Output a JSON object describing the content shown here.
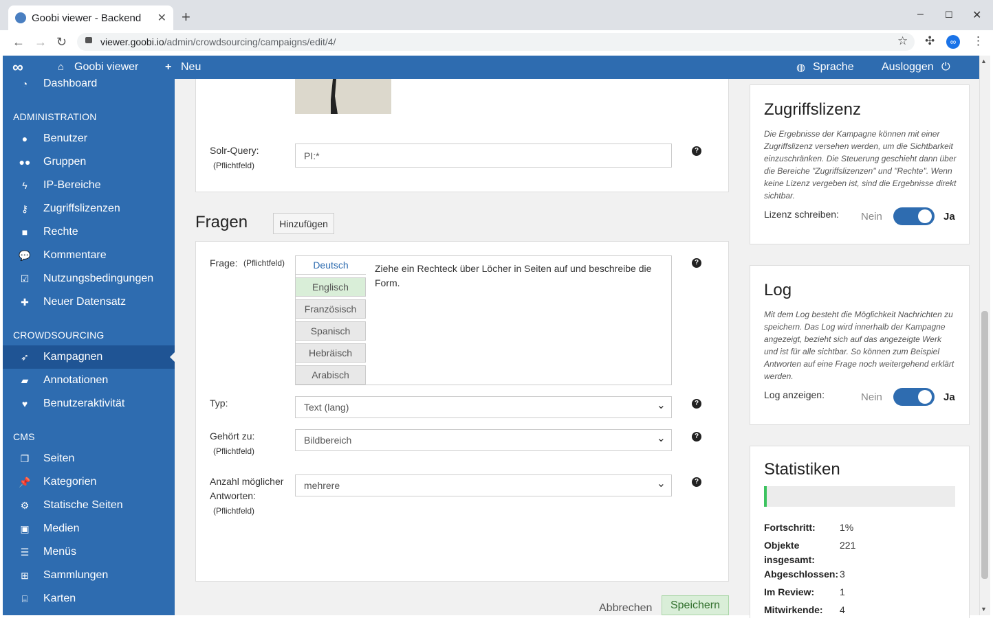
{
  "browser": {
    "tab_title": "Goobi viewer - Backend",
    "url_host": "viewer.goobi.io",
    "url_path": "/admin/crowdsourcing/campaigns/edit/4/"
  },
  "topnav": {
    "brand": "Goobi viewer",
    "new": "Neu",
    "language": "Sprache",
    "logout": "Ausloggen"
  },
  "sidebar": {
    "dashboard": "Dashboard",
    "admin_heading": "ADMINISTRATION",
    "admin_items": [
      "Benutzer",
      "Gruppen",
      "IP-Bereiche",
      "Zugriffslizenzen",
      "Rechte",
      "Kommentare",
      "Nutzungsbedingungen",
      "Neuer Datensatz"
    ],
    "crowd_heading": "CROWDSOURCING",
    "crowd_items": [
      "Kampagnen",
      "Annotationen",
      "Benutzeraktivität"
    ],
    "cms_heading": "CMS",
    "cms_items": [
      "Seiten",
      "Kategorien",
      "Statische Seiten",
      "Medien",
      "Menüs",
      "Sammlungen",
      "Karten"
    ]
  },
  "main": {
    "solr_label": "Solr-Query:",
    "required": "(Pflichtfeld)",
    "solr_value": "PI:*",
    "questions_heading": "Fragen",
    "add_button": "Hinzufügen",
    "question_label": "Frage:",
    "languages": [
      "Deutsch",
      "Englisch",
      "Französisch",
      "Spanisch",
      "Hebräisch",
      "Arabisch"
    ],
    "question_text": "Ziehe ein Rechteck über Löcher in Seiten auf und beschreibe die Form.",
    "type_label": "Typ:",
    "type_value": "Text (lang)",
    "belongs_label": "Gehört zu:",
    "belongs_value": "Bildbereich",
    "answers_label_1": "Anzahl möglicher",
    "answers_label_2": "Antworten:",
    "answers_value": "mehrere",
    "cancel": "Abbrechen",
    "save": "Speichern"
  },
  "license": {
    "title": "Zugriffslizenz",
    "description": "Die Ergebnisse der Kampagne können mit einer Zugriffslizenz versehen werden, um die Sichtbarkeit einzuschränken. Die Steuerung geschieht dann über die Bereiche \"Zugriffslizenzen\" und \"Rechte\". Wenn keine Lizenz vergeben ist, sind die Ergebnisse direkt sichtbar.",
    "toggle_label": "Lizenz schreiben:",
    "no": "Nein",
    "yes": "Ja"
  },
  "log": {
    "title": "Log",
    "description": "Mit dem Log besteht die Möglichkeit Nachrichten zu speichern. Das Log wird innerhalb der Kampagne angezeigt, bezieht sich auf das angezeigte Werk und ist für alle sichtbar. So können zum Beispiel Antworten auf eine Frage noch weitergehend erklärt werden.",
    "toggle_label": "Log anzeigen:",
    "no": "Nein",
    "yes": "Ja"
  },
  "stats": {
    "title": "Statistiken",
    "progress_fraction": 0.01,
    "rows": [
      {
        "key": "Fortschritt:",
        "value": "1%"
      },
      {
        "key": "Objekte insgesamt:",
        "value": "221"
      },
      {
        "key": "Abgeschlossen:",
        "value": "3"
      },
      {
        "key": "Im Review:",
        "value": "1"
      },
      {
        "key": "Mitwirkende:",
        "value": "4"
      }
    ]
  },
  "colors": {
    "primary": "#2e6cb0",
    "active": "#1f5494",
    "progress": "#3cc35f"
  }
}
